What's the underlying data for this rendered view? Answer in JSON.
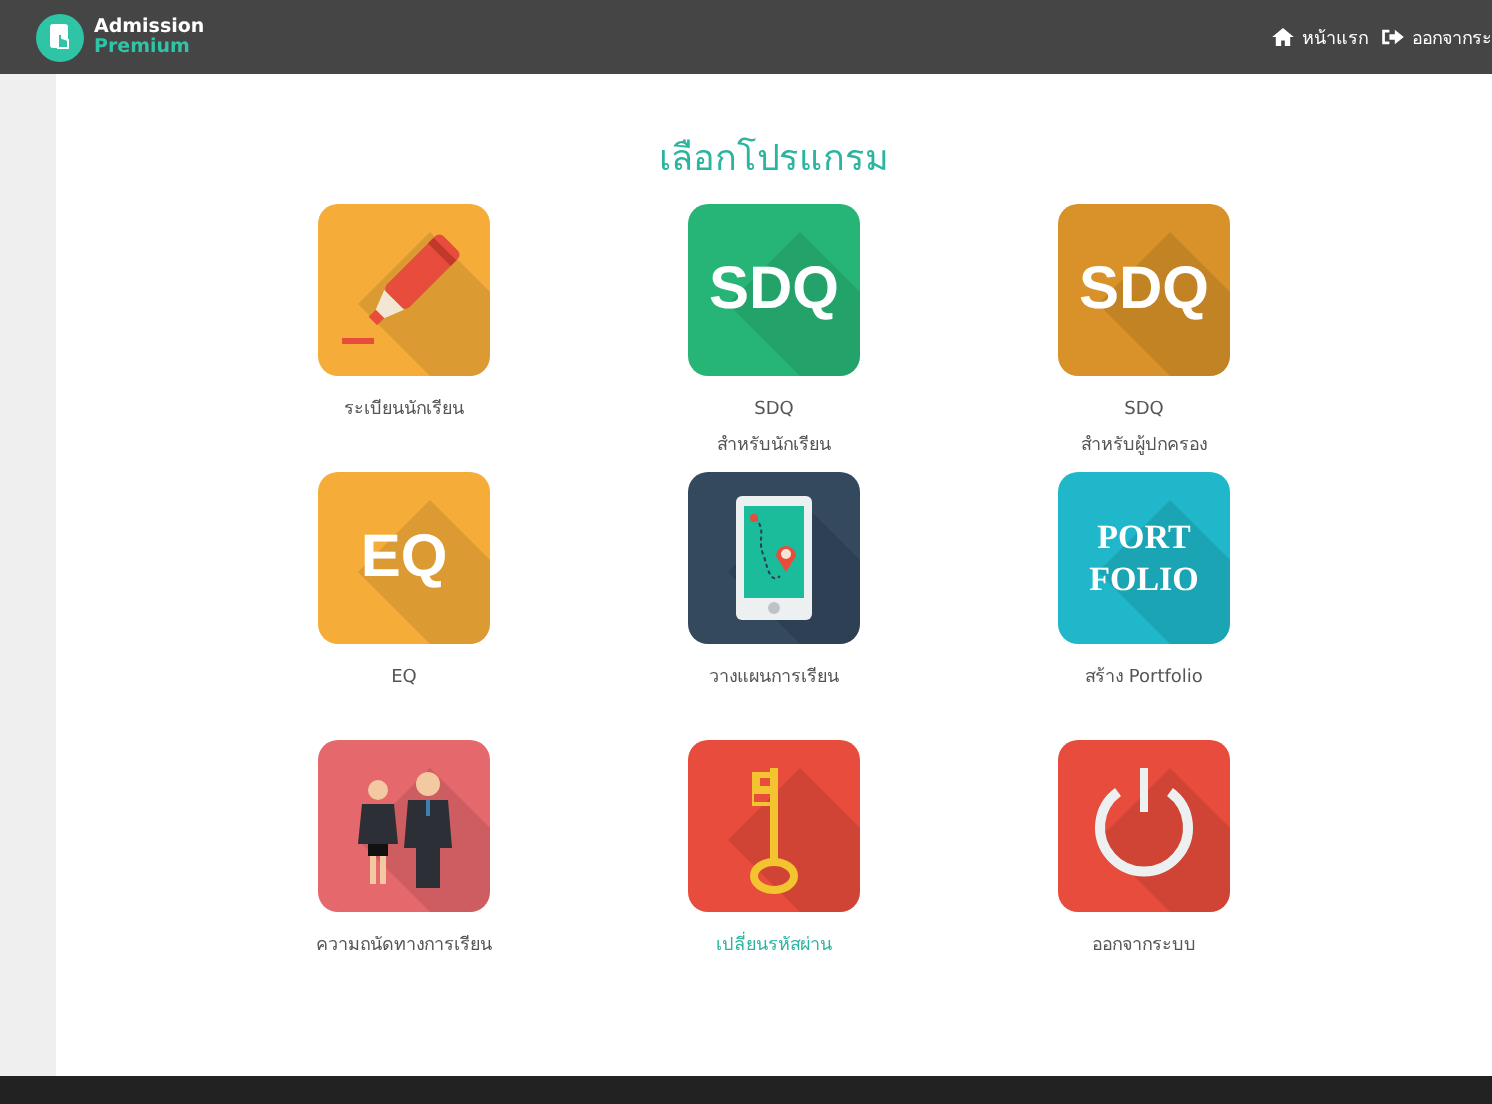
{
  "header": {
    "brand_top": "Admission",
    "brand_bottom": "Premium",
    "nav": [
      {
        "kind": "home",
        "label": "หน้าแรก"
      },
      {
        "kind": "logout",
        "label": "ออกจากระ"
      }
    ]
  },
  "title": "เลือกโปรแกรม",
  "tiles": [
    {
      "kind": "marker",
      "color": "#f5ac39",
      "label": [
        "ระเบียนนักเรียน"
      ],
      "selected": false
    },
    {
      "kind": "text",
      "color": "#27b577",
      "text": [
        "SDQ"
      ],
      "label": [
        "SDQ",
        "สำหรับนักเรียน"
      ],
      "selected": false
    },
    {
      "kind": "text",
      "color": "#d99229",
      "text": [
        "SDQ"
      ],
      "label": [
        "SDQ",
        "สำหรับผู้ปกครอง"
      ],
      "selected": false
    },
    {
      "kind": "text",
      "color": "#f5ac39",
      "text": [
        "EQ"
      ],
      "label": [
        "EQ"
      ],
      "selected": false
    },
    {
      "kind": "phone",
      "color": "#34495e",
      "label": [
        "วางแผนการเรียน"
      ],
      "selected": false
    },
    {
      "kind": "serif",
      "color": "#1fb7c9",
      "text": [
        "PORT",
        "FOLIO"
      ],
      "label": [
        "สร้าง Portfolio"
      ],
      "selected": false
    },
    {
      "kind": "people",
      "color": "#e5686c",
      "label": [
        "ความถนัดทางการเรียน"
      ],
      "selected": false
    },
    {
      "kind": "key",
      "color": "#e74c3c",
      "label": [
        "เปลี่ยนรหัสผ่าน"
      ],
      "selected": true
    },
    {
      "kind": "power",
      "color": "#e74c3c",
      "label": [
        "ออกจากระบบ"
      ],
      "selected": false
    }
  ]
}
